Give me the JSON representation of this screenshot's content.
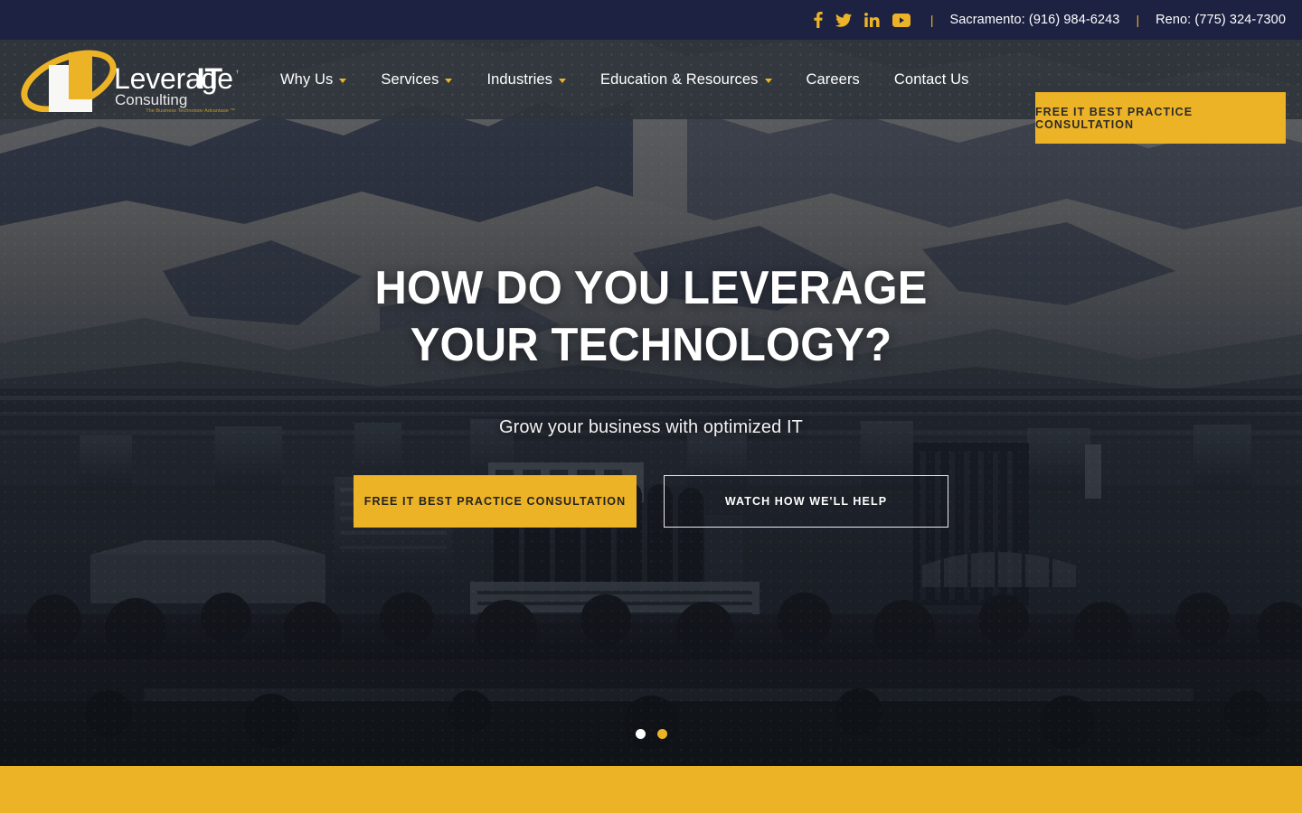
{
  "topbar": {
    "social": [
      {
        "name": "facebook-icon",
        "label": "Facebook"
      },
      {
        "name": "twitter-icon",
        "label": "Twitter"
      },
      {
        "name": "linkedin-icon",
        "label": "LinkedIn"
      },
      {
        "name": "youtube-icon",
        "label": "YouTube"
      }
    ],
    "separator": "|",
    "phone_sacramento": "Sacramento: (916) 984-6243",
    "phone_reno": "Reno: (775) 324-7300"
  },
  "logo": {
    "name_part1": "Leverage",
    "name_part2": "IT",
    "trademark": "™",
    "subtitle": "Consulting",
    "tagline": "The Business Technology Advantage ™"
  },
  "nav": {
    "items": [
      {
        "label": "Why Us",
        "has_dropdown": true
      },
      {
        "label": "Services",
        "has_dropdown": true
      },
      {
        "label": "Industries",
        "has_dropdown": true
      },
      {
        "label": "Education & Resources",
        "has_dropdown": true
      },
      {
        "label": "Careers",
        "has_dropdown": false
      },
      {
        "label": "Contact Us",
        "has_dropdown": false
      }
    ],
    "cta_label": "FREE IT BEST PRACTICE CONSULTATION"
  },
  "hero": {
    "title_line1": "HOW DO YOU LEVERAGE",
    "title_line2": "YOUR TECHNOLOGY?",
    "subtitle": "Grow your business with optimized IT",
    "primary_button": "FREE IT BEST PRACTICE CONSULTATION",
    "secondary_button": "WATCH HOW WE'LL HELP",
    "slides": [
      {
        "index": 1,
        "active": false
      },
      {
        "index": 2,
        "active": true
      }
    ]
  },
  "colors": {
    "accent_yellow": "#edb326",
    "topbar_navy": "#1d2242",
    "header_slate": "#2f353b",
    "text_white": "#ffffff"
  }
}
